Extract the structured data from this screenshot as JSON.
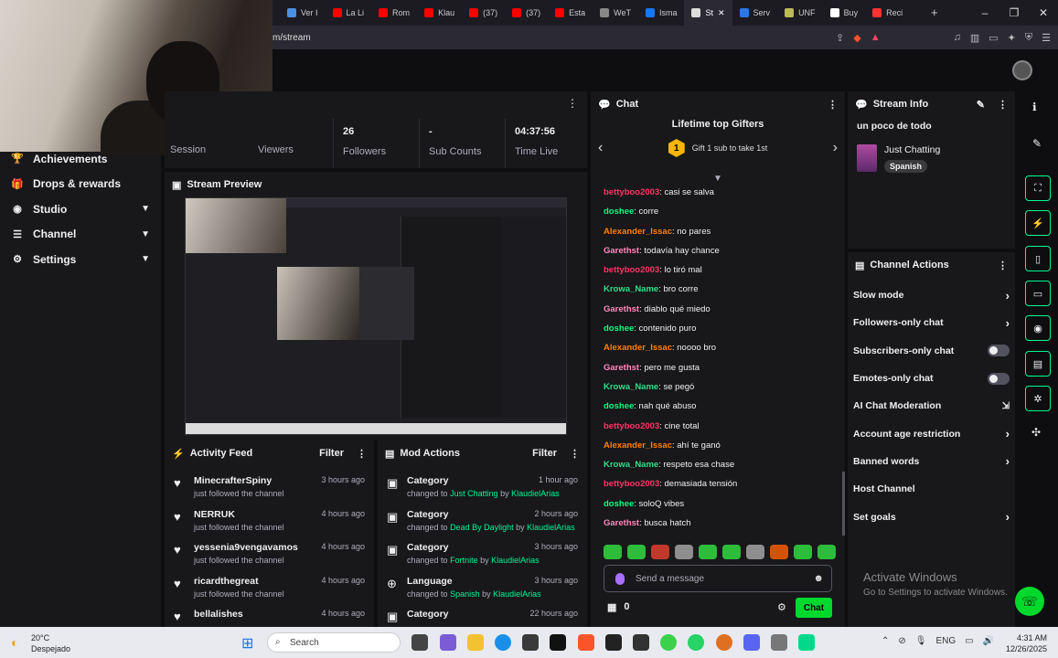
{
  "browser": {
    "tabs": [
      {
        "label": "Ver I",
        "color": "#4a90e2"
      },
      {
        "label": "La Li",
        "color": "#ff0000"
      },
      {
        "label": "Rom",
        "color": "#ff0000"
      },
      {
        "label": "Klau",
        "color": "#ff0000"
      },
      {
        "label": "(37)",
        "color": "#ff0000"
      },
      {
        "label": "(37)",
        "color": "#ff0000"
      },
      {
        "label": "Esta",
        "color": "#ff0000"
      },
      {
        "label": "WeT",
        "color": "#888888"
      },
      {
        "label": "Isma",
        "color": "#1877f2"
      },
      {
        "label": "St",
        "color": "#dddddd"
      },
      {
        "label": "Serv",
        "color": "#2b78e4"
      },
      {
        "label": "UNF",
        "color": "#bbbb55"
      },
      {
        "label": "Buy",
        "color": "#ffffff"
      },
      {
        "label": "Reci",
        "color": "#ff3333"
      }
    ],
    "url": "m/stream"
  },
  "sidenav": {
    "items": [
      {
        "label": "Achievements",
        "icon": "trophy-icon",
        "glyph": "🏆",
        "chevron": false
      },
      {
        "label": "Drops & rewards",
        "icon": "gift-icon",
        "glyph": "🎁",
        "chevron": false
      },
      {
        "label": "Studio",
        "icon": "camera-icon",
        "glyph": "◉",
        "chevron": true
      },
      {
        "label": "Channel",
        "icon": "channel-icon",
        "glyph": "☰",
        "chevron": true
      },
      {
        "label": "Settings",
        "icon": "gear-icon",
        "glyph": "⚙",
        "chevron": true
      }
    ]
  },
  "stats": {
    "session": "Session",
    "viewers": "Viewers",
    "followers_value": "26",
    "followers_label": "Followers",
    "subs_value": "-",
    "subs_label": "Sub Counts",
    "time_value": "04:37:56",
    "time_label": "Time Live"
  },
  "preview": {
    "title": "Stream Preview"
  },
  "activity": {
    "title": "Activity Feed",
    "filter": "Filter",
    "items": [
      {
        "name": "MinecrafterSpiny",
        "sub": "just followed the channel",
        "time": "3 hours ago"
      },
      {
        "name": "NERRUK",
        "sub": "just followed the channel",
        "time": "4 hours ago"
      },
      {
        "name": "yessenia9vengavamos",
        "sub": "just followed the channel",
        "time": "4 hours ago"
      },
      {
        "name": "ricardthegreat",
        "sub": "just followed the channel",
        "time": "4 hours ago"
      },
      {
        "name": "bellalishes",
        "sub": "",
        "time": "4 hours ago"
      }
    ]
  },
  "mod": {
    "title": "Mod Actions",
    "filter": "Filter",
    "items": [
      {
        "name": "Category",
        "pre": "changed to",
        "val": "Just Chatting",
        "by": "by",
        "user": "KlaudielArias",
        "time": "1 hour ago"
      },
      {
        "name": "Category",
        "pre": "changed to",
        "val": "Dead By Daylight",
        "by": "by",
        "user": "KlaudielArias",
        "time": "2 hours ago"
      },
      {
        "name": "Category",
        "pre": "changed to",
        "val": "Fortnite",
        "by": "by",
        "user": "KlaudielArias",
        "time": "3 hours ago"
      },
      {
        "name": "Language",
        "pre": "changed to",
        "val": "Spanish",
        "by": "by",
        "user": "KlaudielArias",
        "time": "3 hours ago"
      },
      {
        "name": "Category",
        "pre": "",
        "val": "",
        "by": "",
        "user": "",
        "time": "22 hours ago"
      }
    ]
  },
  "chat": {
    "title": "Chat",
    "gifters_title": "Lifetime top Gifters",
    "gifters_rank": "1",
    "gifters_text": "Gift 1 sub to take 1st",
    "placeholder": "Send a message",
    "points": "0",
    "send_label": "Chat",
    "messages": [
      {
        "user": "bettyboo2003",
        "color": "#ff3366",
        "text": ": casi se salva"
      },
      {
        "user": "doshee",
        "color": "#00ff7f",
        "text": ": corre"
      },
      {
        "user": "Alexander_Issac",
        "color": "#ff7f00",
        "text": ": no pares"
      },
      {
        "user": "Garethst",
        "color": "#ff88bb",
        "text": ": todavía hay chance"
      },
      {
        "user": "bettyboo2003",
        "color": "#ff3366",
        "text": ": lo tiró mal"
      },
      {
        "user": "Krowa_Name",
        "color": "#33dd88",
        "text": ": bro corre"
      },
      {
        "user": "Garethst",
        "color": "#ff88bb",
        "text": ": diablo qué miedo"
      },
      {
        "user": "doshee",
        "color": "#00ff7f",
        "text": ": contenido puro"
      },
      {
        "user": "Alexander_Issac",
        "color": "#ff7f00",
        "text": ": noooo bro"
      },
      {
        "user": "Garethst",
        "color": "#ff88bb",
        "text": ": pero me gusta"
      },
      {
        "user": "Krowa_Name",
        "color": "#33dd88",
        "text": ": se pegó"
      },
      {
        "user": "doshee",
        "color": "#00ff7f",
        "text": ": nah qué abuso"
      },
      {
        "user": "bettyboo2003",
        "color": "#ff3366",
        "text": ": cine total"
      },
      {
        "user": "Alexander_Issac",
        "color": "#ff7f00",
        "text": ": ahí te ganó"
      },
      {
        "user": "Krowa_Name",
        "color": "#33dd88",
        "text": ": respeto esa chase"
      },
      {
        "user": "bettyboo2003",
        "color": "#ff3366",
        "text": ": demasiada tensión"
      },
      {
        "user": "doshee",
        "color": "#00ff7f",
        "text": ": soloQ vibes"
      },
      {
        "user": "Garethst",
        "color": "#ff88bb",
        "text": ": busca hatch"
      }
    ]
  },
  "stream_info": {
    "title": "Stream Info",
    "stream_title": "un poco de todo",
    "category": "Just Chatting",
    "language": "Spanish"
  },
  "channel_actions": {
    "title": "Channel Actions",
    "items": [
      {
        "label": "Slow mode",
        "control": "chevron"
      },
      {
        "label": "Followers-only chat",
        "control": "chevron"
      },
      {
        "label": "Subscribers-only chat",
        "control": "toggle"
      },
      {
        "label": "Emotes-only chat",
        "control": "toggle"
      },
      {
        "label": "AI Chat Moderation",
        "control": "external"
      },
      {
        "label": "Account age restriction",
        "control": "chevron"
      },
      {
        "label": "Banned words",
        "control": "chevron"
      },
      {
        "label": "Host Channel",
        "control": "none"
      },
      {
        "label": "Set goals",
        "control": "chevron"
      }
    ]
  },
  "watermark": {
    "line1": "Activate Windows",
    "line2": "Go to Settings to activate Windows."
  },
  "taskbar": {
    "temp": "20°C",
    "weather": "Despejado",
    "search": "Search",
    "lang": "ENG",
    "time": "4:31 AM",
    "date": "12/26/2025"
  },
  "colors": {
    "accent": "#00f593",
    "panel": "#18181b",
    "bg": "#0e0e10"
  }
}
